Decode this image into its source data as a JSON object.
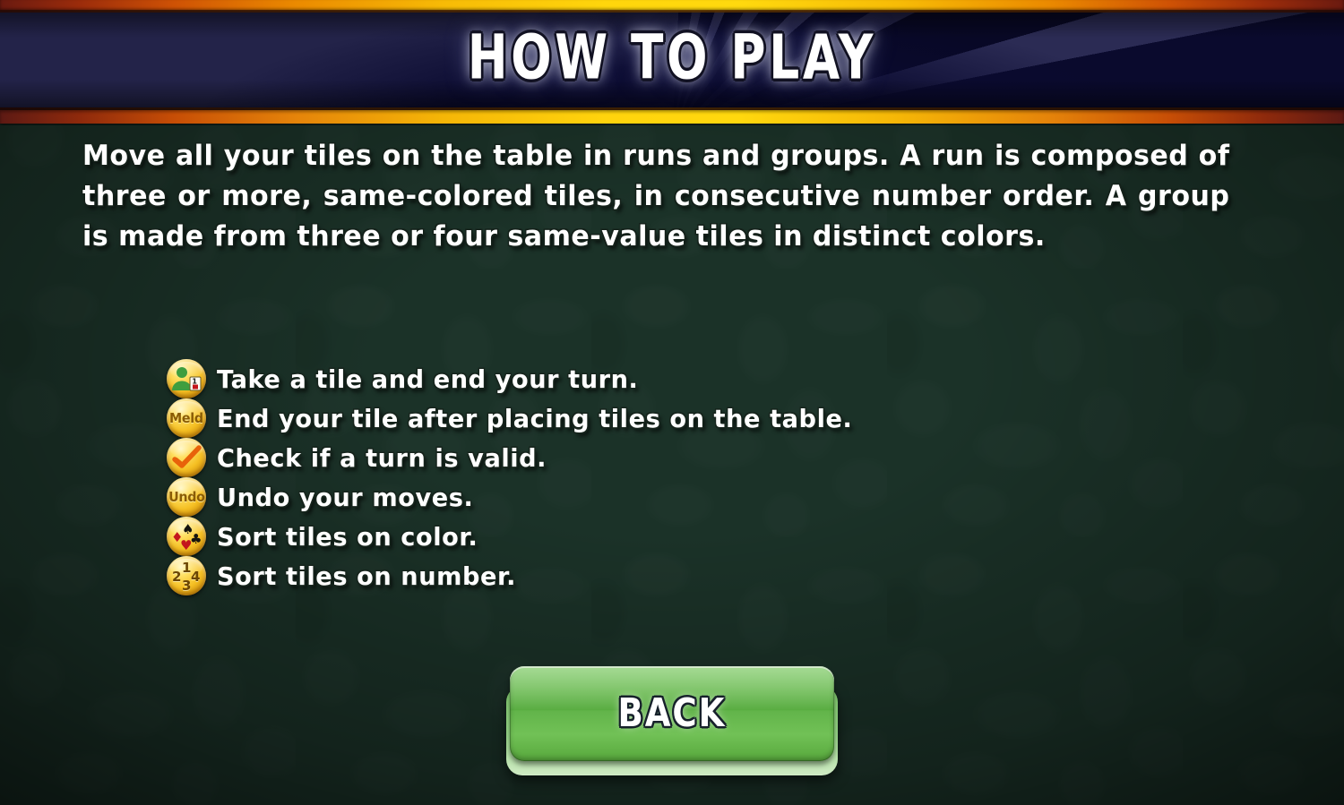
{
  "header": {
    "title": "HOW TO PLAY",
    "colors": {
      "bar_center": "#ffd60c",
      "bar_edge": "#6a1a10",
      "ray_dark": "#0a0a30",
      "ray_light": "#3b3b66"
    }
  },
  "intro": {
    "text": "Move all your tiles on the table in runs and groups. A run is composed of three or more, same-colored tiles, in consecutive number order. A group is made from three or four same-value tiles in distinct colors."
  },
  "legend": {
    "items": [
      {
        "icon": "player-take-tile-icon",
        "icon_label": "",
        "label": "Take a tile and end your turn."
      },
      {
        "icon": "meld-icon",
        "icon_label": "Meld",
        "label": "End your tile after placing tiles on the table."
      },
      {
        "icon": "check-valid-icon",
        "icon_label": "",
        "label": "Check if a turn is valid."
      },
      {
        "icon": "undo-icon",
        "icon_label": "Undo",
        "label": "Undo your moves."
      },
      {
        "icon": "sort-by-color-icon",
        "icon_label": "",
        "label": "Sort tiles on color."
      },
      {
        "icon": "sort-by-number-icon",
        "icon_label": "",
        "label": "Sort tiles on number."
      }
    ],
    "suits": {
      "spade": "♠",
      "diamond": "♦",
      "club": "♣",
      "heart": "♥"
    },
    "numbers": {
      "one": "1",
      "two": "2",
      "three": "3",
      "four": "4"
    },
    "card_value": "1"
  },
  "footer": {
    "back_label": "BACK",
    "back_color": "#62b44a"
  },
  "background": {
    "felt_color": "#1b3228"
  }
}
